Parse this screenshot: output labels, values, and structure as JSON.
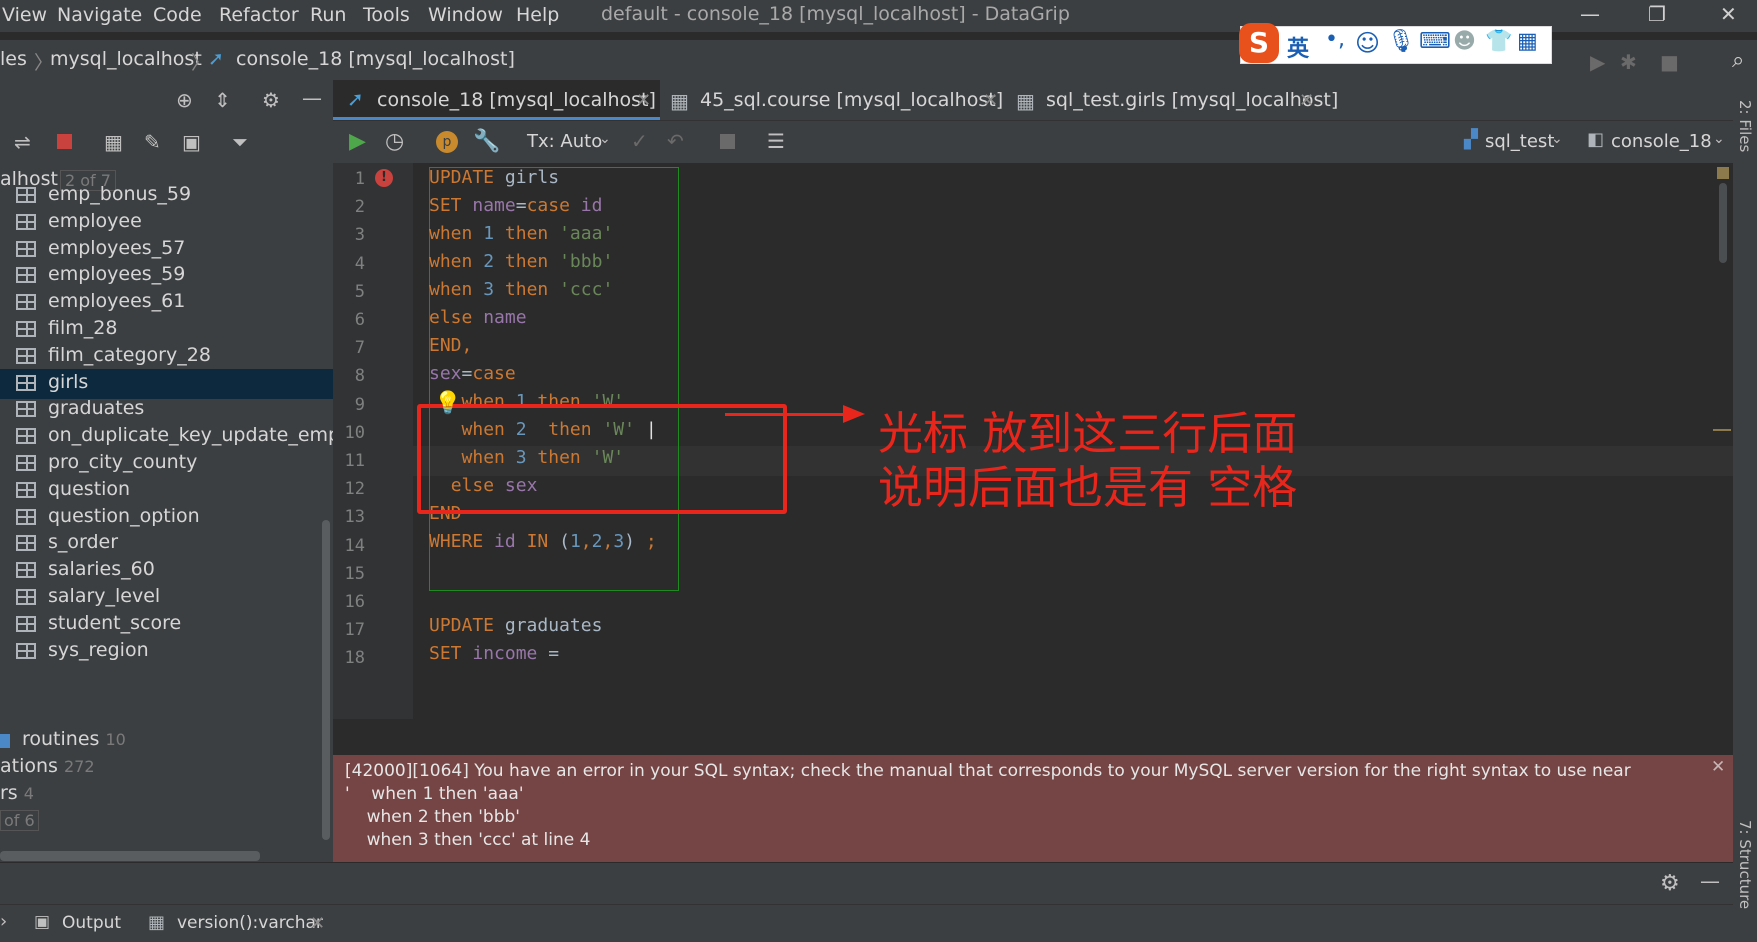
{
  "menubar": {
    "items": [
      "View",
      "Navigate",
      "Code",
      "Refactor",
      "Run",
      "Tools",
      "Window",
      "Help"
    ],
    "window_title": "default - console_18 [mysql_localhost] - DataGrip"
  },
  "navbar": {
    "crumb_1": "les",
    "crumb_2": "mysql_localhost",
    "crumb_3": "console_18 [mysql_localhost]"
  },
  "ime": {
    "lang": "英"
  },
  "tree": {
    "root_label": "alhost",
    "root_badge": "2 of 7",
    "tables": [
      "emp_bonus_59",
      "employee",
      "employees_57",
      "employees_59",
      "employees_61",
      "film_28",
      "film_category_28",
      "girls",
      "graduates",
      "on_duplicate_key_update_employ",
      "pro_city_county",
      "question",
      "question_option",
      "s_order",
      "salaries_60",
      "salary_level",
      "student_score",
      "sys_region"
    ],
    "selected": "girls",
    "routines_label": "routines",
    "routines_count": "10",
    "rows_tail": [
      {
        "label": "ations",
        "count": "272"
      },
      {
        "label": "rs",
        "count": "4"
      },
      {
        "label": "",
        "count": "of 6"
      }
    ]
  },
  "tabs": [
    {
      "label": "console_18 [mysql_localhost]",
      "active": true
    },
    {
      "label": "45_sql.course [mysql_localhost]",
      "active": false
    },
    {
      "label": "sql_test.girls [mysql_localhost]",
      "active": false
    }
  ],
  "toolbar": {
    "tx_mode": "Tx: Auto",
    "schema": "sql_test",
    "session": "console_18"
  },
  "editor": {
    "line_numbers": [
      "1",
      "2",
      "3",
      "4",
      "5",
      "6",
      "7",
      "8",
      "9",
      "10",
      "11",
      "12",
      "13",
      "14",
      "15",
      "16",
      "17",
      "18"
    ]
  },
  "error": {
    "line1": "[42000][1064] You have an error in your SQL syntax; check the manual that corresponds to your MySQL server version for the right syntax to use near",
    "line2": "'    when 1 then 'aaa'",
    "line3": "    when 2 then 'bbb'",
    "line4": "    when 3 then 'ccc' at line 4"
  },
  "annotation": {
    "line1": "光标 放到这三行后面",
    "line2": "说明后面也是有 空格"
  },
  "bottom": {
    "output_label": "Output",
    "result_tab": "version():varchar"
  },
  "right_stripe": {
    "files": "2: Files",
    "structure": "7: Structure"
  },
  "colors": {
    "keyword": "#cc7832",
    "string": "#6a8759",
    "number": "#6897bb",
    "field": "#9876aa",
    "annotation": "#e8261c",
    "error_bg": "#744544"
  }
}
